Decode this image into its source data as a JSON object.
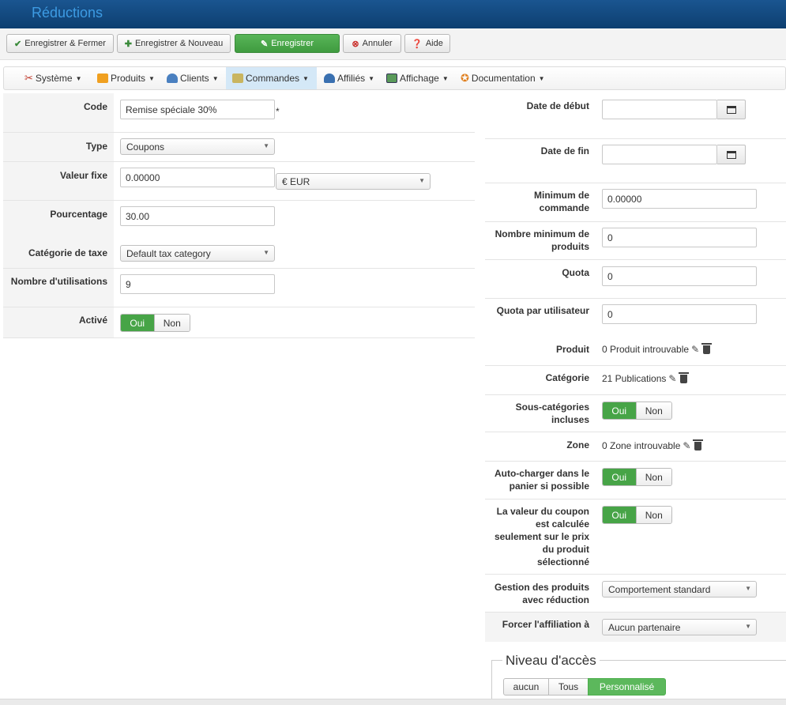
{
  "window": {
    "title": "Réductions"
  },
  "toolbar": {
    "save_close": "Enregistrer & Fermer",
    "save_new": "Enregistrer & Nouveau",
    "save": "Enregistrer",
    "cancel": "Annuler",
    "help": "Aide"
  },
  "menu": {
    "items": [
      {
        "label": "Système"
      },
      {
        "label": "Produits"
      },
      {
        "label": "Clients"
      },
      {
        "label": "Commandes"
      },
      {
        "label": "Affiliés"
      },
      {
        "label": "Affichage"
      },
      {
        "label": "Documentation"
      }
    ],
    "active_index": 3
  },
  "left": {
    "code": {
      "label": "Code",
      "value": "Remise spéciale 30%",
      "required_mark": "*"
    },
    "type": {
      "label": "Type",
      "value": "Coupons"
    },
    "fixed_value": {
      "label": "Valeur fixe",
      "value": "0.00000",
      "currency": "€ EUR"
    },
    "percent": {
      "label": "Pourcentage",
      "value": "30.00"
    },
    "tax_category": {
      "label": "Catégorie de taxe",
      "value": "Default tax category"
    },
    "uses": {
      "label": "Nombre d'utilisations",
      "value": "9"
    },
    "active": {
      "label": "Activé",
      "yes": "Oui",
      "no": "Non",
      "selected": "yes"
    }
  },
  "right": {
    "start_date": {
      "label": "Date de début",
      "value": ""
    },
    "end_date": {
      "label": "Date de fin",
      "value": ""
    },
    "min_order": {
      "label": "Minimum de commande",
      "value": "0.00000"
    },
    "min_products": {
      "label": "Nombre minimum de produits",
      "value": "0"
    },
    "quota": {
      "label": "Quota",
      "value": "0"
    },
    "quota_user": {
      "label": "Quota par utilisateur",
      "value": "0"
    },
    "product": {
      "label": "Produit",
      "value": "0 Produit introuvable"
    },
    "category": {
      "label": "Catégorie",
      "value": "21 Publications"
    },
    "subcategories": {
      "label": "Sous-catégories incluses",
      "yes": "Oui",
      "no": "Non",
      "selected": "yes"
    },
    "zone": {
      "label": "Zone",
      "value": "0 Zone introuvable"
    },
    "autoload": {
      "label": "Auto-charger dans le panier si possible",
      "yes": "Oui",
      "no": "Non",
      "selected": "yes"
    },
    "coupon_value_product": {
      "label": "La valeur du coupon est calculée seulement sur le prix du produit sélectionné",
      "yes": "Oui",
      "no": "Non",
      "selected": "yes"
    },
    "discounted_products": {
      "label": "Gestion des produits avec réduction",
      "value": "Comportement standard"
    },
    "force_affiliate": {
      "label": "Forcer l'affiliation à",
      "value": "Aucun partenaire"
    }
  },
  "access": {
    "legend": "Niveau d'accès",
    "options": [
      "aucun",
      "Tous",
      "Personnalisé"
    ],
    "selected_index": 2
  },
  "colors": {
    "title_bar": "#0d3f70",
    "title_text": "#3d9be3",
    "green": "#47a447",
    "active_menu": "#d4e8f7"
  }
}
